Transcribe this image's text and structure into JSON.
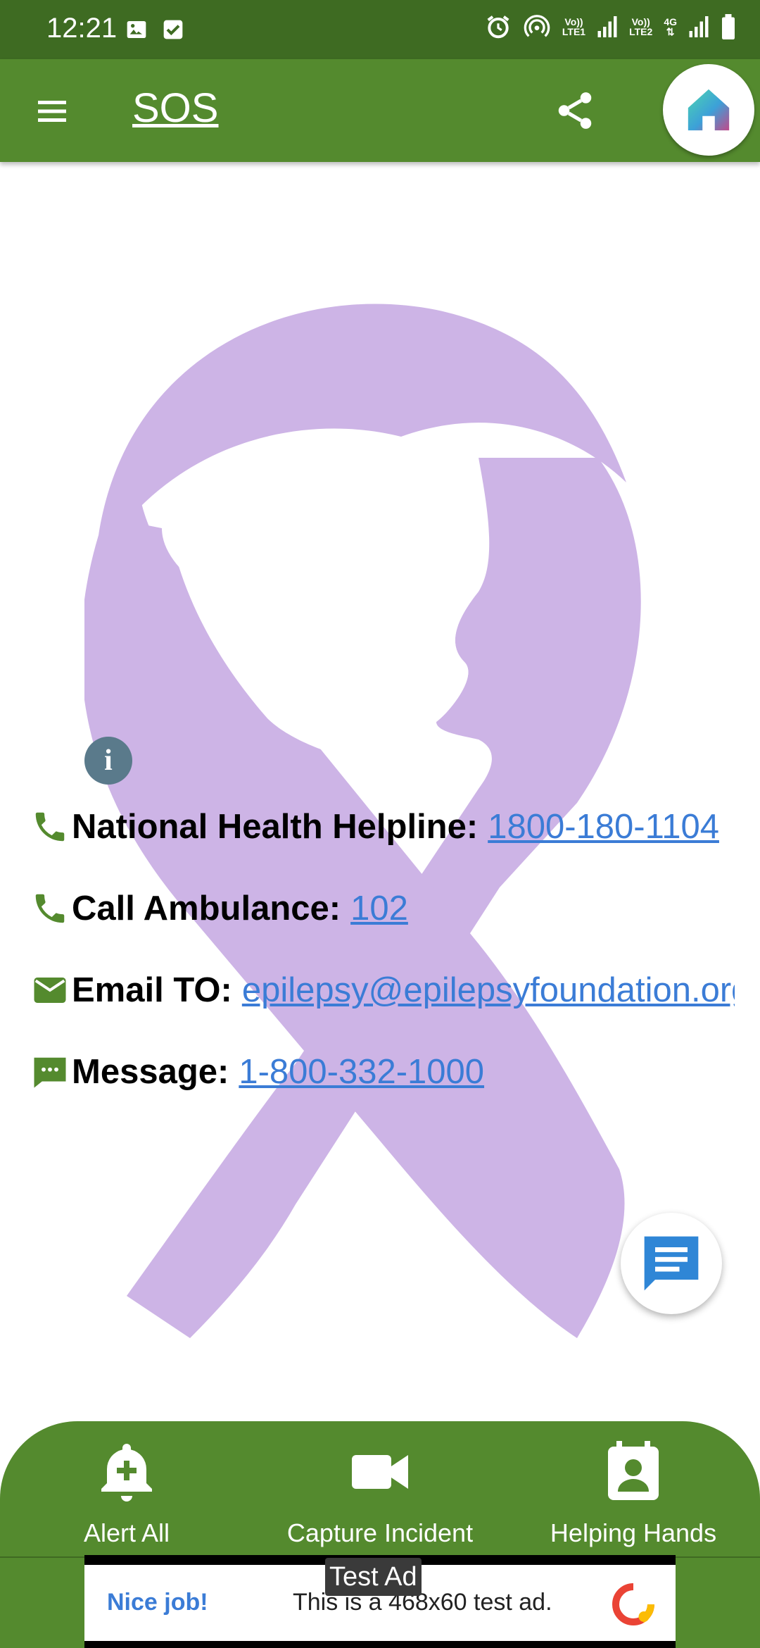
{
  "status_bar": {
    "time": "12:21",
    "net1": [
      "Vo))",
      "LTE1"
    ],
    "net2": [
      "Vo))",
      "LTE2"
    ],
    "net_type": "4G"
  },
  "app_bar": {
    "title": "SOS",
    "icons": [
      "menu-icon",
      "share-icon",
      "home-icon"
    ]
  },
  "contacts": [
    {
      "icon": "phone-icon",
      "label": "National Health Helpline:",
      "value": "1800-180-1104"
    },
    {
      "icon": "phone-icon",
      "label": "Call Ambulance:",
      "value": "102"
    },
    {
      "icon": "email-icon",
      "label": "Email TO:",
      "value": "epilepsy@epilepsyfoundation.org"
    },
    {
      "icon": "message-icon",
      "label": "Message:",
      "value": "1-800-332-1000"
    }
  ],
  "bottom_nav": [
    {
      "icon": "bell-plus-icon",
      "label": "Alert All"
    },
    {
      "icon": "video-camera-icon",
      "label": "Capture Incident"
    },
    {
      "icon": "contact-badge-icon",
      "label": "Helping Hands"
    }
  ],
  "ad": {
    "tag": "Test Ad",
    "headline": "Nice job!",
    "body": "This is a 468x60 test ad."
  },
  "colors": {
    "status_bar": "#3e6b22",
    "primary": "#548a2e",
    "ribbon": "#cdb4e6",
    "link": "#3b7cd6",
    "info": "#5a7a8b"
  }
}
